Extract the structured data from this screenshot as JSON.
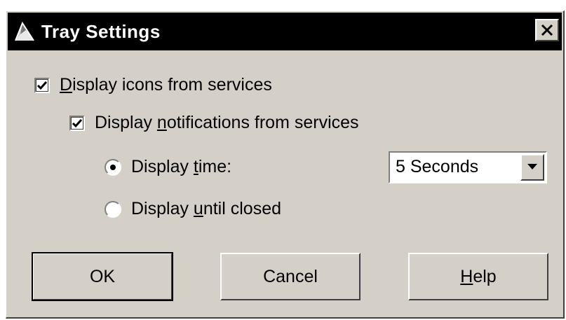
{
  "window": {
    "title": "Tray Settings"
  },
  "options": {
    "display_icons": {
      "label_accel": "D",
      "label_rest": "isplay icons from services",
      "checked": true
    },
    "display_notifications": {
      "label_pre": "Display ",
      "label_accel": "n",
      "label_rest": "otifications from services",
      "checked": true
    },
    "display_time": {
      "label_pre": "Display ",
      "label_accel": "t",
      "label_rest": "ime:",
      "selected": true
    },
    "display_until_closed": {
      "label_pre": "Display ",
      "label_accel": "u",
      "label_rest": "ntil closed",
      "selected": false
    }
  },
  "time_select": {
    "value": "5 Seconds"
  },
  "buttons": {
    "ok": "OK",
    "cancel": "Cancel",
    "help_accel": "H",
    "help_rest": "elp"
  },
  "icons": {
    "app": "tray-settings-app-icon",
    "close": "close-icon",
    "check": "checkmark-icon",
    "dropdown": "chevron-down-icon"
  }
}
